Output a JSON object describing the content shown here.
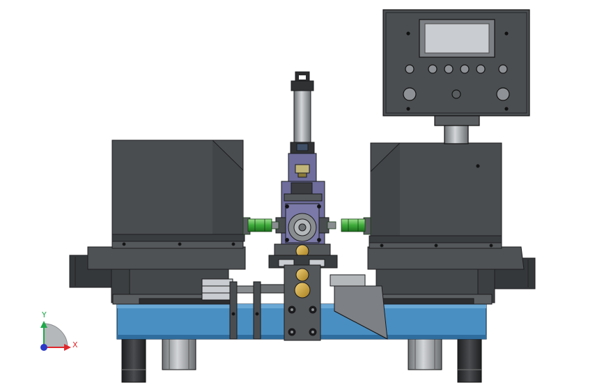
{
  "view": {
    "background": "#ffffff",
    "colors": {
      "housing": "#4a4d50",
      "housing_dark": "#2f3133",
      "housing_light": "#5c5f62",
      "base_blue": "#4a8fc2",
      "base_blue_dark": "#2f6d9e",
      "steel": "#8a8d90",
      "steel_light": "#b5b8bb",
      "purple": "#6e6d9c",
      "brass": "#c9a135",
      "green": "#3daa3a",
      "screen": "#c9ccd0"
    }
  },
  "triad": {
    "x_label": "X",
    "y_label": "Y",
    "x_color": "#e0282c",
    "y_color": "#1fa84a",
    "z_color": "#2a39c8"
  }
}
